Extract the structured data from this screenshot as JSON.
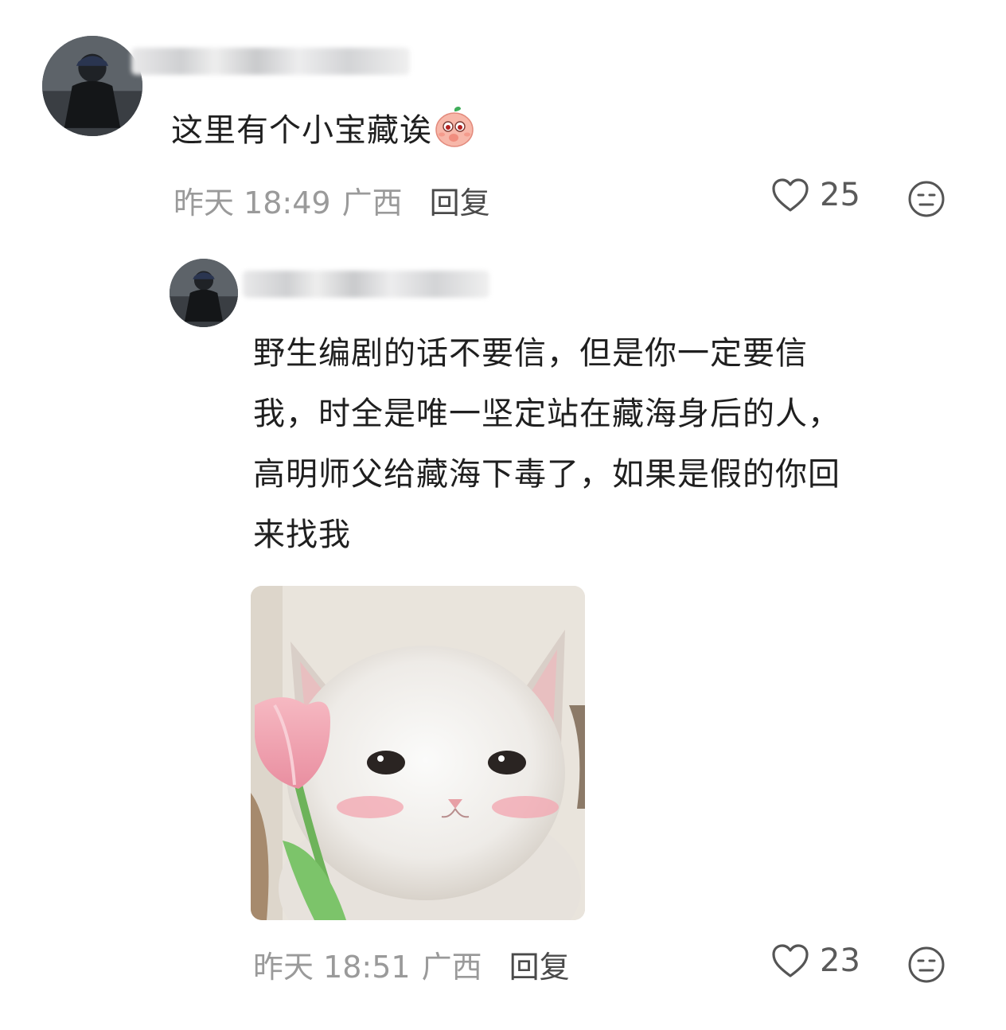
{
  "comments": [
    {
      "text": "这里有个小宝藏诶",
      "emoji": "peach-face-icon",
      "time": "昨天 18:49",
      "location": "广西",
      "reply_label": "回复",
      "likes": "25"
    },
    {
      "text": "野生编剧的话不要信，但是你一定要信我，时全是唯一坚定站在藏海身后的人，高明师父给藏海下毒了，如果是假的你回来找我",
      "lines": [
        "野生编剧的话不要信，但是你一定要信",
        "我，时全是唯一坚定站在藏海身后的人，",
        "高明师父给藏海下毒了，如果是假的你回",
        "来找我"
      ],
      "sticker": "white-cat-with-tulip-sticker",
      "time": "昨天 18:51",
      "location": "广西",
      "reply_label": "回复",
      "likes": "23"
    }
  ],
  "icons": {
    "like": "heart-outline-icon",
    "dislike": "meh-face-icon"
  },
  "colors": {
    "meta": "#9a9a9a",
    "text": "#1f1f1f",
    "icon": "#5a5a5a"
  }
}
